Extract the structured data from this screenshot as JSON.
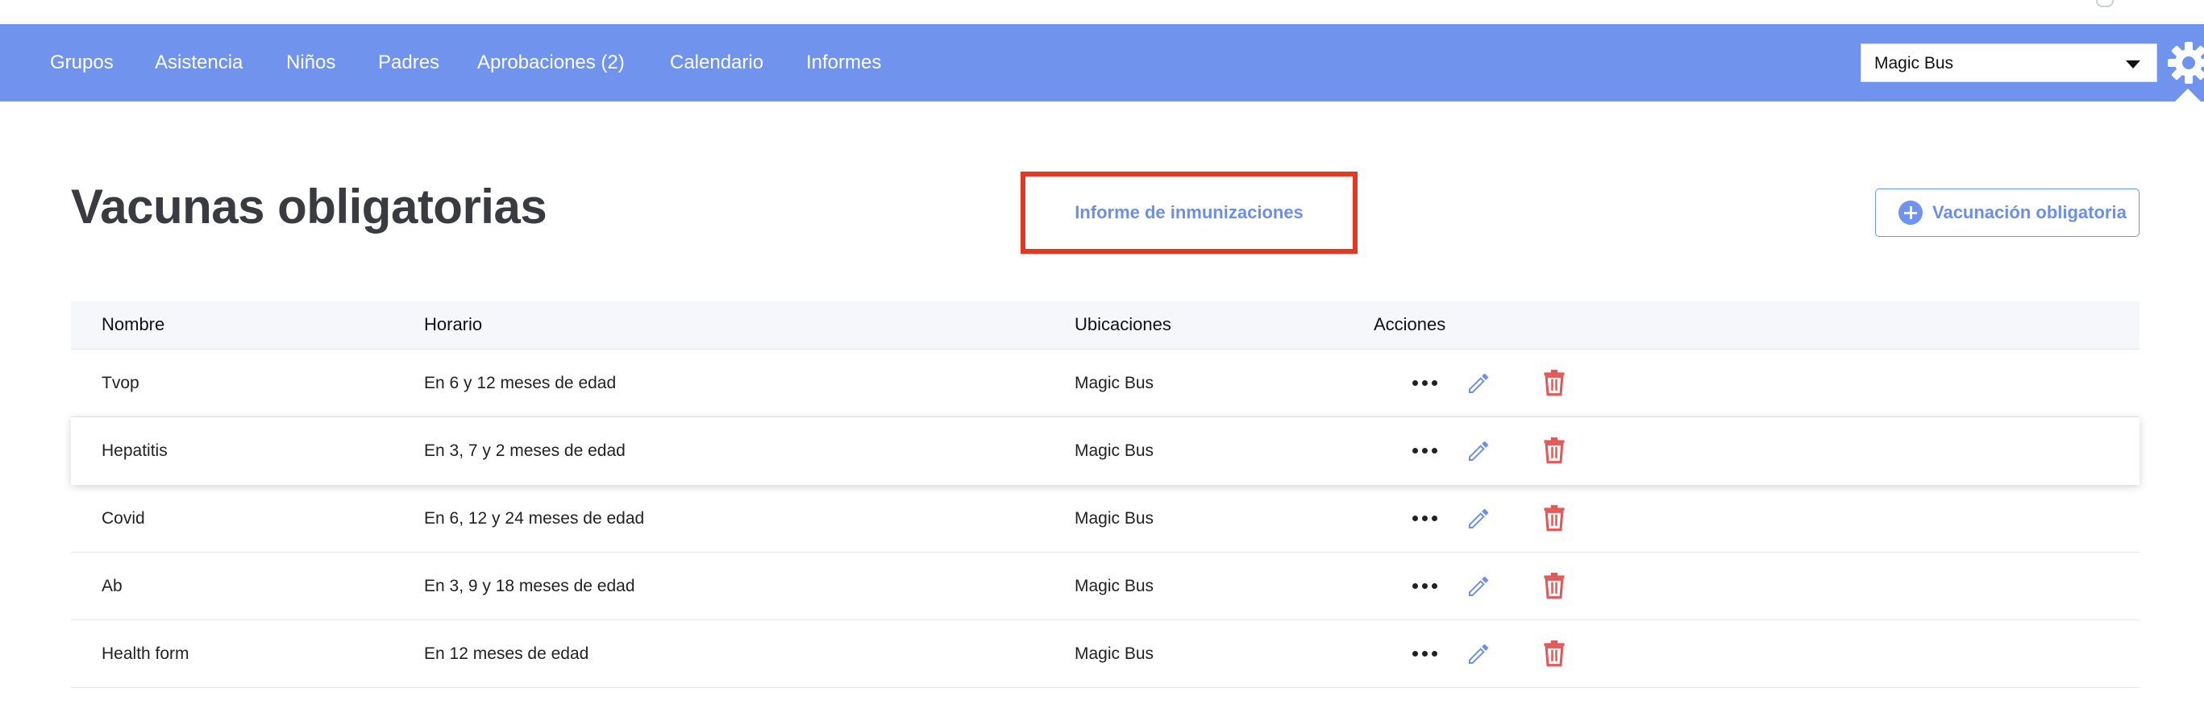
{
  "colors": {
    "navbar": "#7094ed",
    "accent": "#6c8fe3",
    "highlight_border": "#e23a22",
    "delete": "#e05a5a"
  },
  "nav": {
    "items": [
      {
        "label": "Grupos"
      },
      {
        "label": "Asistencia"
      },
      {
        "label": "Niños"
      },
      {
        "label": "Padres"
      },
      {
        "label": "Aprobaciones (2)"
      },
      {
        "label": "Calendario"
      },
      {
        "label": "Informes"
      }
    ],
    "location_select": {
      "value": "Magic Bus"
    },
    "settings_icon": "gear-icon"
  },
  "page": {
    "title": "Vacunas obligatorias",
    "report_link": "Informe de inmunizaciones",
    "add_button": {
      "label": "Vacunación obligatoria",
      "icon": "plus-circle-icon"
    }
  },
  "table": {
    "headers": {
      "name": "Nombre",
      "schedule": "Horario",
      "locations": "Ubicaciones",
      "actions": "Acciones"
    },
    "rows": [
      {
        "name": "Tvop",
        "schedule": "En 6 y 12 meses de edad",
        "locations": "Magic Bus"
      },
      {
        "name": "Hepatitis",
        "schedule": "En 3, 7 y 2 meses de edad",
        "locations": "Magic Bus"
      },
      {
        "name": "Covid",
        "schedule": "En 6, 12 y 24 meses de edad",
        "locations": "Magic Bus"
      },
      {
        "name": "Ab",
        "schedule": "En 3, 9 y 18 meses de edad",
        "locations": "Magic Bus"
      },
      {
        "name": "Health form",
        "schedule": "En 12 meses de edad",
        "locations": "Magic Bus"
      }
    ],
    "row_action_icons": [
      "more-icon",
      "edit-pencil-icon",
      "trash-icon"
    ]
  }
}
